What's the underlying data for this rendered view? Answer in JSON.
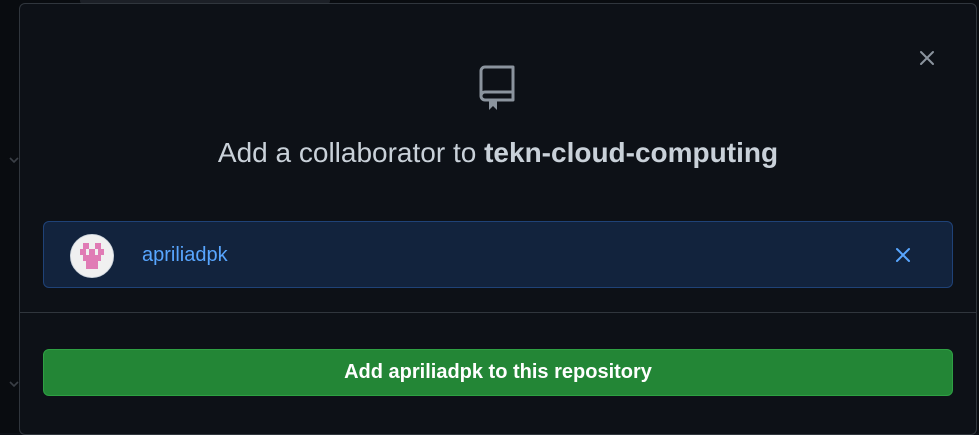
{
  "dialog": {
    "title_prefix": "Add a collaborator to ",
    "repo_name": "tekn-cloud-computing",
    "close_icon": "close-icon",
    "header_icon": "repo-icon"
  },
  "selected_user": {
    "username": "apriliadpk",
    "avatar_icon": "identicon-avatar",
    "remove_icon": "close-icon"
  },
  "actions": {
    "add_button_label": "Add apriliadpk to this repository"
  },
  "colors": {
    "accent_blue": "#58a6ff",
    "primary_green": "#238636",
    "background": "#0d1117"
  }
}
